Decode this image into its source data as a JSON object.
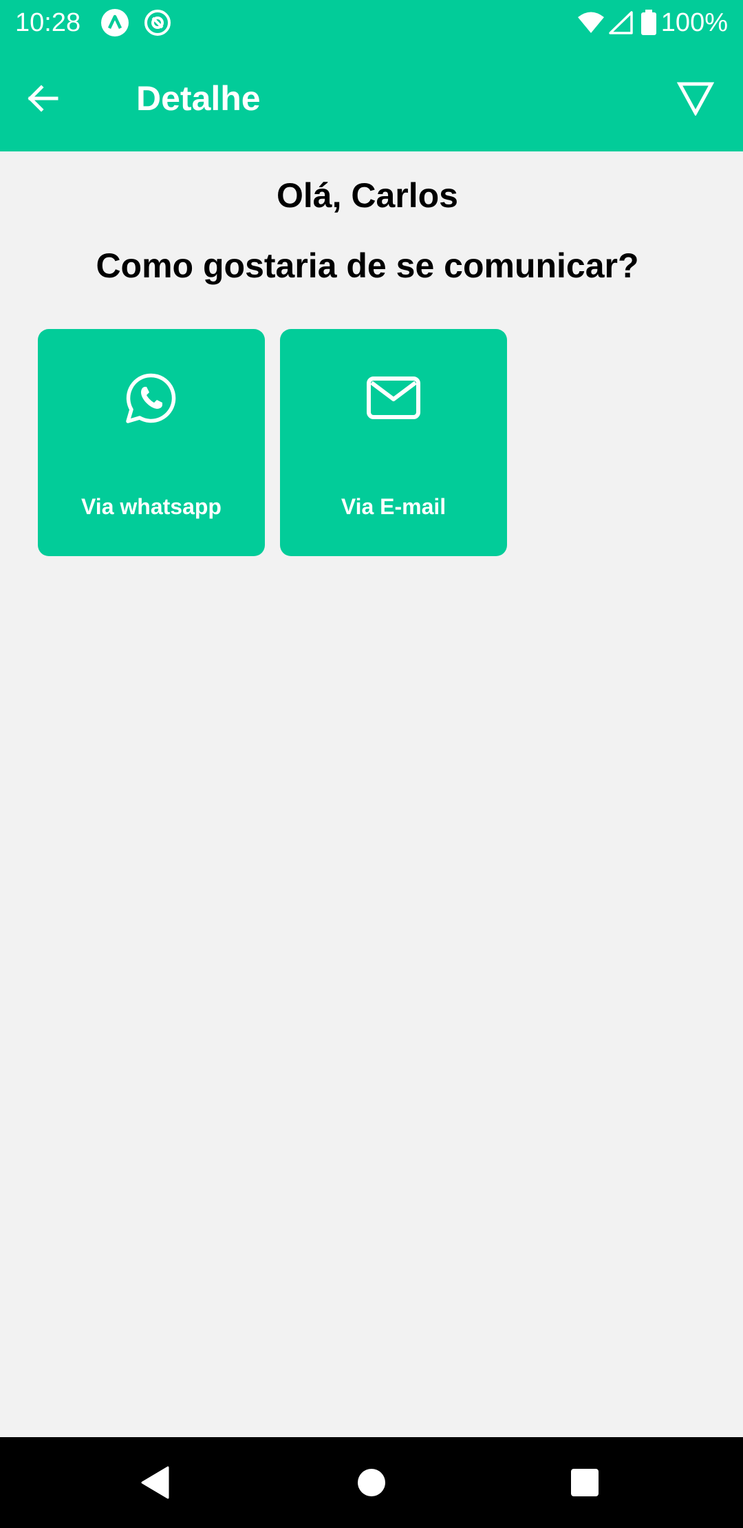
{
  "status_bar": {
    "time": "10:28",
    "battery": "100%",
    "icons": [
      "app-notification-icon",
      "at-sign-notification-icon",
      "wifi-icon",
      "cell-signal-icon",
      "battery-icon"
    ]
  },
  "app_bar": {
    "title": "Detalhe",
    "icons": [
      "arrow-left-icon",
      "filter-icon"
    ]
  },
  "main": {
    "greeting": "Olá, Carlos",
    "question": "Como gostaria de se comunicar?",
    "options": [
      {
        "label": "Via whatsapp",
        "icon": "whatsapp-icon"
      },
      {
        "label": "Via E-mail",
        "icon": "mail-icon"
      }
    ]
  },
  "nav_bar": {
    "icons": [
      "nav-back-icon",
      "nav-home-icon",
      "nav-recents-icon"
    ]
  },
  "colors": {
    "accent": "#02cc99",
    "background": "#f2f2f2",
    "text": "#000000",
    "on_accent": "#ffffff",
    "nav_bar": "#000000"
  }
}
